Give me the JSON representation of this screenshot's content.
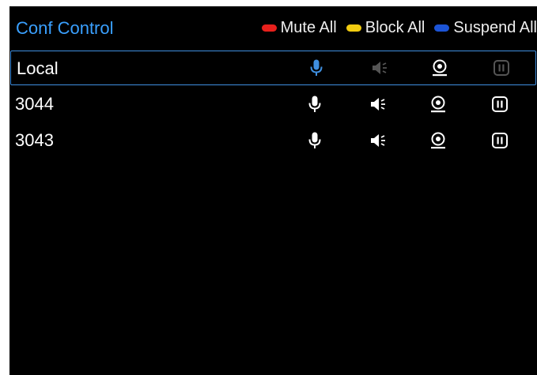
{
  "header": {
    "title": "Conf Control",
    "actions": [
      {
        "label": "Mute All",
        "color": "#e8201c"
      },
      {
        "label": "Block All",
        "color": "#f2cc10"
      },
      {
        "label": "Suspend All",
        "color": "#1c54d6"
      }
    ]
  },
  "participants": [
    {
      "name": "Local",
      "selected": true,
      "mic_icon": "microphone-icon",
      "speaker_icon": "speaker-icon",
      "camera_icon": "camera-icon",
      "pause_icon": "pause-icon",
      "speaker_disabled": true,
      "pause_disabled": true
    },
    {
      "name": "3044",
      "selected": false,
      "mic_icon": "microphone-icon",
      "speaker_icon": "speaker-icon",
      "camera_icon": "camera-icon",
      "pause_icon": "pause-icon",
      "speaker_disabled": false,
      "pause_disabled": false
    },
    {
      "name": "3043",
      "selected": false,
      "mic_icon": "microphone-icon",
      "speaker_icon": "speaker-icon",
      "camera_icon": "camera-icon",
      "pause_icon": "pause-icon",
      "speaker_disabled": false,
      "pause_disabled": false
    }
  ],
  "colors": {
    "accent": "#3aa0ff",
    "active_mic": "#3f8fe0",
    "icon": "#ffffff",
    "icon_disabled": "#555555"
  }
}
